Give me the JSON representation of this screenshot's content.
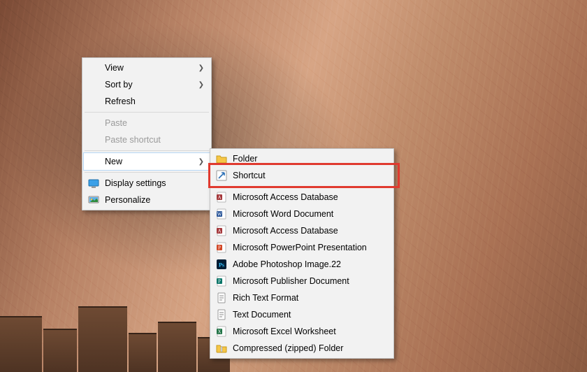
{
  "context_menu": {
    "view": {
      "label": "View",
      "has_submenu": true
    },
    "sort_by": {
      "label": "Sort by",
      "has_submenu": true
    },
    "refresh": {
      "label": "Refresh"
    },
    "paste": {
      "label": "Paste",
      "enabled": false
    },
    "paste_shortcut": {
      "label": "Paste shortcut",
      "enabled": false
    },
    "new": {
      "label": "New",
      "has_submenu": true,
      "selected": true
    },
    "display_settings": {
      "label": "Display settings"
    },
    "personalize": {
      "label": "Personalize"
    }
  },
  "new_submenu": {
    "items": [
      {
        "label": "Folder",
        "icon": "folder-icon"
      },
      {
        "label": "Shortcut",
        "icon": "shortcut-icon",
        "highlighted": true
      },
      {
        "label": "Microsoft Access Database",
        "icon": "access-icon"
      },
      {
        "label": "Microsoft Word Document",
        "icon": "word-icon"
      },
      {
        "label": "Microsoft Access Database",
        "icon": "access-icon"
      },
      {
        "label": "Microsoft PowerPoint Presentation",
        "icon": "powerpoint-icon"
      },
      {
        "label": "Adobe Photoshop Image.22",
        "icon": "photoshop-icon"
      },
      {
        "label": "Microsoft Publisher Document",
        "icon": "publisher-icon"
      },
      {
        "label": "Rich Text Format",
        "icon": "rtf-icon"
      },
      {
        "label": "Text Document",
        "icon": "text-icon"
      },
      {
        "label": "Microsoft Excel Worksheet",
        "icon": "excel-icon"
      },
      {
        "label": "Compressed (zipped) Folder",
        "icon": "zip-icon"
      }
    ]
  }
}
